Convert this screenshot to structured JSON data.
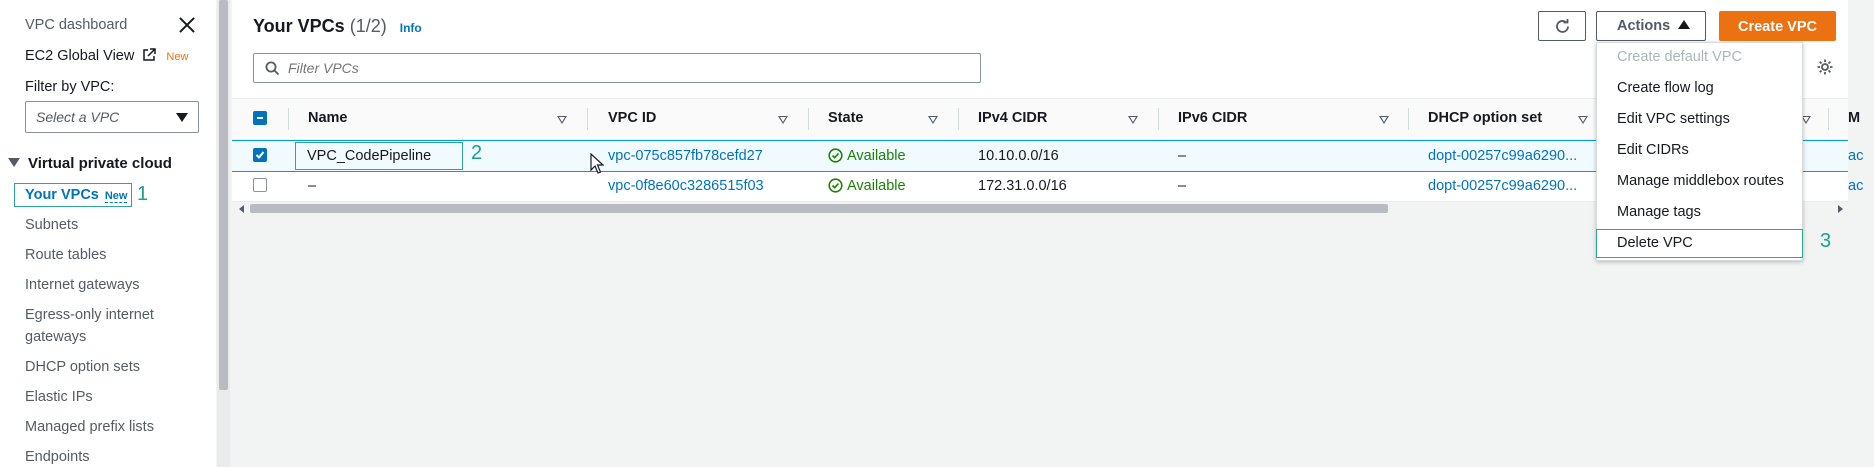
{
  "sidebar": {
    "dashboard": "VPC dashboard",
    "ec2_global_view": "EC2 Global View",
    "new_badge": "New",
    "filter_label": "Filter by VPC:",
    "select_placeholder": "Select a VPC",
    "section_title": "Virtual private cloud",
    "your_vpcs": "Your VPCs",
    "your_vpcs_badge": "New",
    "items": [
      "Subnets",
      "Route tables",
      "Internet gateways",
      "Egress-only internet",
      "gateways",
      "DHCP option sets",
      "Elastic IPs",
      "Managed prefix lists",
      "Endpoints"
    ]
  },
  "annotations": {
    "one": "1",
    "two": "2",
    "three": "3"
  },
  "header": {
    "title": "Your VPCs",
    "count": "(1/2)",
    "info": "Info",
    "filter_placeholder": "Filter VPCs",
    "actions_label": "Actions",
    "create_label": "Create VPC"
  },
  "table": {
    "columns": [
      "Name",
      "VPC ID",
      "State",
      "IPv4 CIDR",
      "IPv6 CIDR",
      "DHCP option set",
      "M"
    ],
    "rows": [
      {
        "name": "VPC_CodePipeline",
        "vpc_id": "vpc-075c857fb78cefd27",
        "state": "Available",
        "ipv4": "10.10.0.0/16",
        "ipv6": "–",
        "dhcp": "dopt-00257c99a6290...",
        "extra": "ac",
        "selected": true
      },
      {
        "name": "–",
        "vpc_id": "vpc-0f8e60c3286515f03",
        "state": "Available",
        "ipv4": "172.31.0.0/16",
        "ipv6": "–",
        "dhcp": "dopt-00257c99a6290...",
        "extra": "ac",
        "selected": false
      }
    ]
  },
  "actions_menu": {
    "items": [
      "Create default VPC",
      "Create flow log",
      "Edit VPC settings",
      "Edit CIDRs",
      "Manage middlebox routes",
      "Manage tags",
      "Delete VPC"
    ]
  },
  "colors": {
    "accent": "#0073bb",
    "primary_button": "#ec7211",
    "annotation": "#1aa28f",
    "available": "#1d8102"
  }
}
